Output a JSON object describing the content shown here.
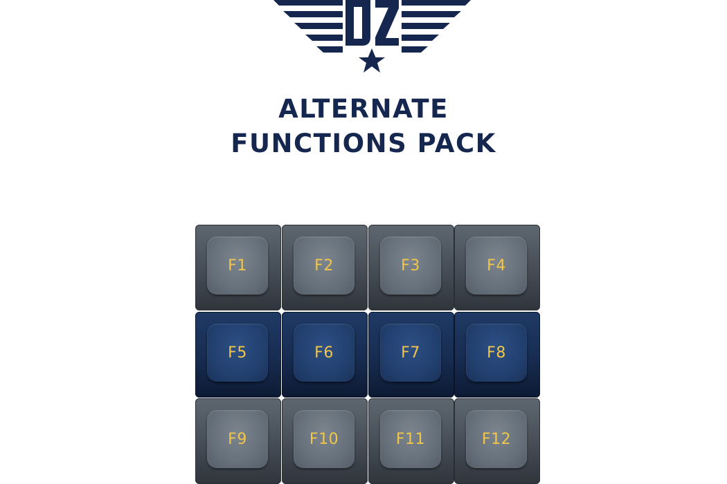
{
  "logo": {
    "text": "DZ"
  },
  "title": {
    "line1": "ALTERNATE",
    "line2": "FUNCTIONS PACK"
  },
  "colors": {
    "navy": "#15274f",
    "legend": "#f1c64a",
    "gray_key": "#4f5760",
    "blue_key": "#1a3259"
  },
  "keys": [
    {
      "label": "F1",
      "color": "gray"
    },
    {
      "label": "F2",
      "color": "gray"
    },
    {
      "label": "F3",
      "color": "gray"
    },
    {
      "label": "F4",
      "color": "gray"
    },
    {
      "label": "F5",
      "color": "blue"
    },
    {
      "label": "F6",
      "color": "blue"
    },
    {
      "label": "F7",
      "color": "blue"
    },
    {
      "label": "F8",
      "color": "blue"
    },
    {
      "label": "F9",
      "color": "gray"
    },
    {
      "label": "F10",
      "color": "gray"
    },
    {
      "label": "F11",
      "color": "gray"
    },
    {
      "label": "F12",
      "color": "gray"
    }
  ]
}
